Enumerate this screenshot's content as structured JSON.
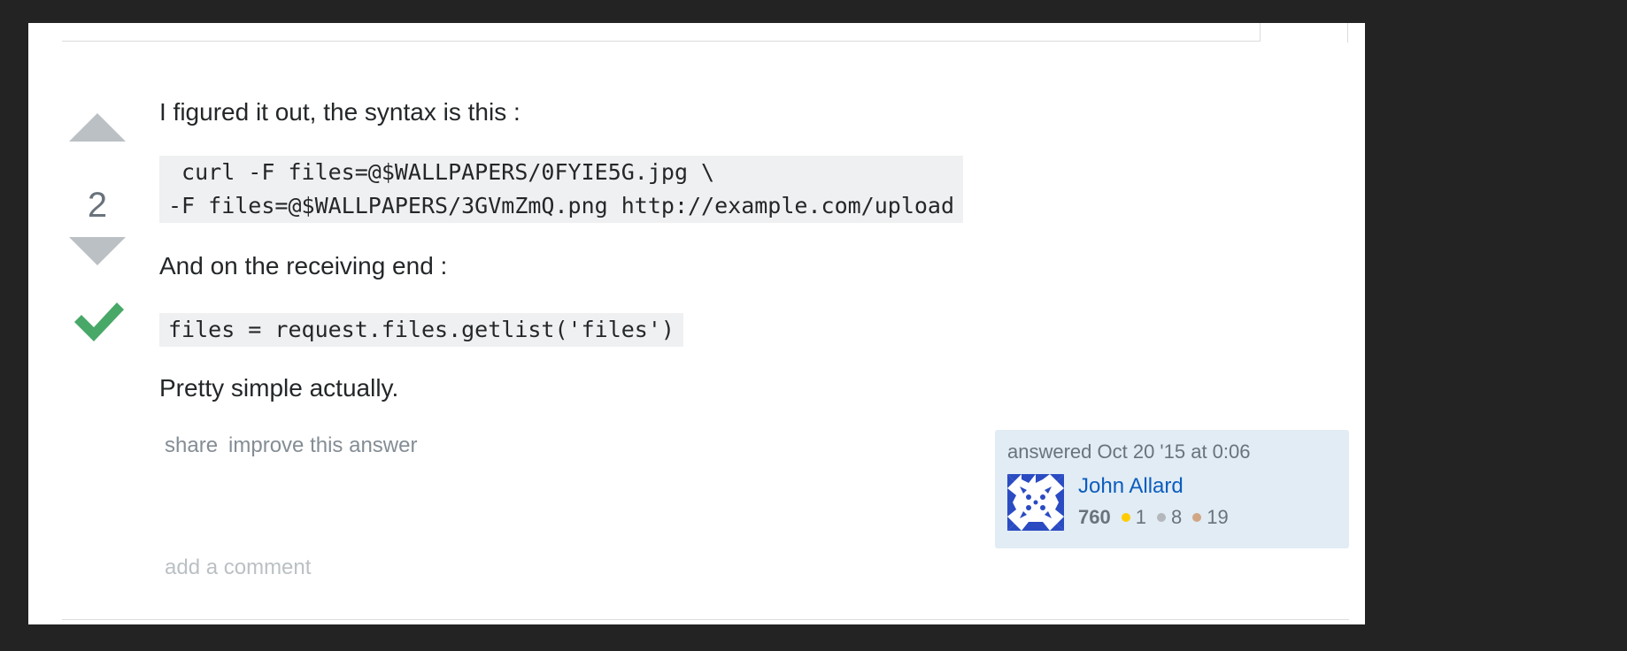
{
  "post": {
    "vote_count": "2",
    "paragraphs": {
      "intro": "I figured it out, the syntax is this :",
      "receiving": "And on the receiving end :",
      "closing": "Pretty simple actually."
    },
    "code": {
      "curl_line_1": " curl -F files=@$WALLPAPERS/0FYIE5G.jpg \\",
      "curl_line_2": "-F files=@$WALLPAPERS/3GVmZmQ.png http://example.com/upload",
      "python_line": "files = request.files.getlist('files')"
    },
    "menu": {
      "share_label": "share",
      "improve_label": "improve this answer"
    },
    "add_comment_label": "add a comment"
  },
  "user_card": {
    "action_time": "answered Oct 20 '15 at 0:06",
    "user_name": "John Allard",
    "reputation": "760",
    "badges": {
      "gold": "1",
      "silver": "8",
      "bronze": "19"
    }
  },
  "colors": {
    "background": "#232323",
    "panel": "#ffffff",
    "vote_arrow": "#bbc0c4",
    "accepted_check": "#48a868",
    "code_background": "#eff0f1",
    "user_card_background": "#e1ecf4",
    "user_link": "#0c5dbe",
    "badge_gold": "#ffcc01",
    "badge_silver": "#b4b8bc",
    "badge_bronze": "#d1a684"
  },
  "icons": {
    "vote_up": "triangle-up-icon",
    "vote_down": "triangle-down-icon",
    "accepted": "checkmark-icon",
    "avatar": "identicon-avatar"
  }
}
